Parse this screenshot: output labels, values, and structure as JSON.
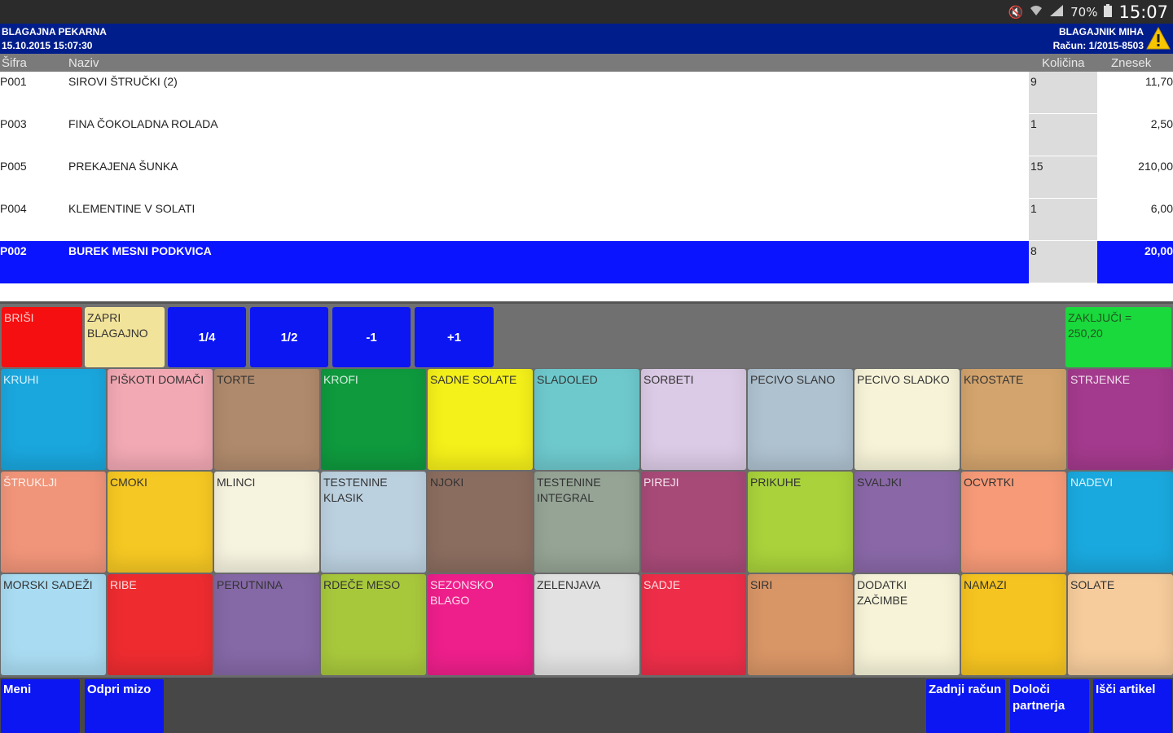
{
  "status_bar": {
    "signal_text": "70%",
    "time": "15:07"
  },
  "header": {
    "store": "BLAGAJNA PEKARNA",
    "datetime": "15.10.2015 15:07:30",
    "cashier": "BLAGAJNIK MIHA",
    "invoice": "Račun: 1/2015-8503"
  },
  "columns": {
    "code": "Šifra",
    "name": "Naziv",
    "qty": "Količina",
    "amount": "Znesek"
  },
  "items": [
    {
      "code": "P001",
      "name": "SIROVI ŠTRUČKI (2)",
      "qty": "9",
      "amount": "11,70"
    },
    {
      "code": "P003",
      "name": "FINA ČOKOLADNA ROLADA",
      "qty": "1",
      "amount": "2,50"
    },
    {
      "code": "P005",
      "name": "PREKAJENA ŠUNKA",
      "qty": "15",
      "amount": "210,00"
    },
    {
      "code": "P004",
      "name": "KLEMENTINE V SOLATI",
      "qty": "1",
      "amount": "6,00"
    },
    {
      "code": "P002",
      "name": "BUREK MESNI PODKVICA",
      "qty": "8",
      "amount": "20,00"
    }
  ],
  "actions": {
    "delete": "BRIŠI",
    "close_register": "ZAPRI BLAGAJNO",
    "quarter": "1/4",
    "half": "1/2",
    "minus": "-1",
    "plus": "+1",
    "finish": "ZAKLJUČI = 250,20"
  },
  "categories": [
    {
      "label": "KRUHI",
      "color": "#1aa7de"
    },
    {
      "label": "PIŠKOTI DOMAČI",
      "color": "#f2a9b4"
    },
    {
      "label": "TORTE",
      "color": "#b08a6c"
    },
    {
      "label": "KROFI",
      "color": "#0f9a3e"
    },
    {
      "label": "SADNE SOLATE",
      "color": "#f4f01a"
    },
    {
      "label": "SLADOLED",
      "color": "#6ec9cd"
    },
    {
      "label": "SORBETI",
      "color": "#dccbe6"
    },
    {
      "label": "PECIVO SLANO",
      "color": "#afc2d0"
    },
    {
      "label": "PECIVO SLADKO",
      "color": "#f6f3d8"
    },
    {
      "label": "KROSTATE",
      "color": "#d3a46d"
    },
    {
      "label": "STRJENKE",
      "color": "#a43a8d"
    },
    {
      "label": "ŠTRUKLJI",
      "color": "#f1957a"
    },
    {
      "label": "CMOKI",
      "color": "#f6c823"
    },
    {
      "label": "MLINCI",
      "color": "#f6f3df"
    },
    {
      "label": "TESTENINE KLASIK",
      "color": "#bcd1e0"
    },
    {
      "label": "NJOKI",
      "color": "#8b6d5f"
    },
    {
      "label": "TESTENINE INTEGRAL",
      "color": "#95a495"
    },
    {
      "label": "PIREJI",
      "color": "#a84a78"
    },
    {
      "label": "PRIKUHE",
      "color": "#a9d23b"
    },
    {
      "label": "SVALJKI",
      "color": "#8a68a8"
    },
    {
      "label": "OCVRTKI",
      "color": "#f69a78"
    },
    {
      "label": "NADEVI",
      "color": "#1aa9df"
    },
    {
      "label": "MORSKI SADEŽI",
      "color": "#a9dcf2"
    },
    {
      "label": "RIBE",
      "color": "#ee2c30"
    },
    {
      "label": "PERUTNINA",
      "color": "#8568a6"
    },
    {
      "label": "RDEČE MESO",
      "color": "#a8c83c"
    },
    {
      "label": "SEZONSKO BLAGO",
      "color": "#ee1f8b"
    },
    {
      "label": "ZELENJAVA",
      "color": "#e2e2e2"
    },
    {
      "label": "SADJE",
      "color": "#ee2e49"
    },
    {
      "label": "SIRI",
      "color": "#d89566"
    },
    {
      "label": "DODATKI ZAČIMBE",
      "color": "#f6f3d8"
    },
    {
      "label": "NAMAZI",
      "color": "#f6c420"
    },
    {
      "label": "SOLATE",
      "color": "#f6cc9c"
    }
  ],
  "bottom": {
    "menu": "Meni",
    "open_table": "Odpri mizo",
    "last_receipt": "Zadnji račun",
    "set_partner": "Določi partnerja",
    "search_item": "Išči artikel"
  },
  "colors": {
    "header_bg": "#001d8c",
    "button_blue": "#0b16f3",
    "selected_row": "#0a14ff"
  }
}
